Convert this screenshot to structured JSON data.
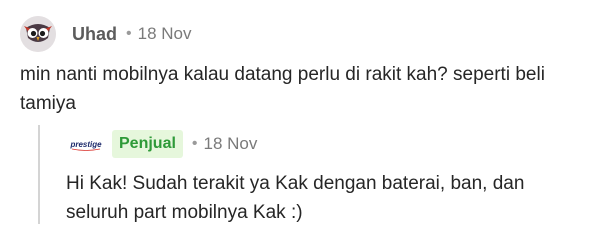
{
  "comment": {
    "avatar_icon": "owl-avatar-icon",
    "user_name": "Uhad",
    "separator": "•",
    "date": "18 Nov",
    "text": "min nanti mobilnya kalau datang perlu di rakit kah? seperti beli tamiya"
  },
  "reply": {
    "logo_text": "prestige",
    "badge": "Penjual",
    "separator": "•",
    "date": "18 Nov",
    "text": "Hi Kak! Sudah terakit ya Kak dengan baterai, ban, dan seluruh part mobilnya Kak :)",
    "badge_bg": "#e6f7dc",
    "badge_color": "#2e9a38"
  }
}
